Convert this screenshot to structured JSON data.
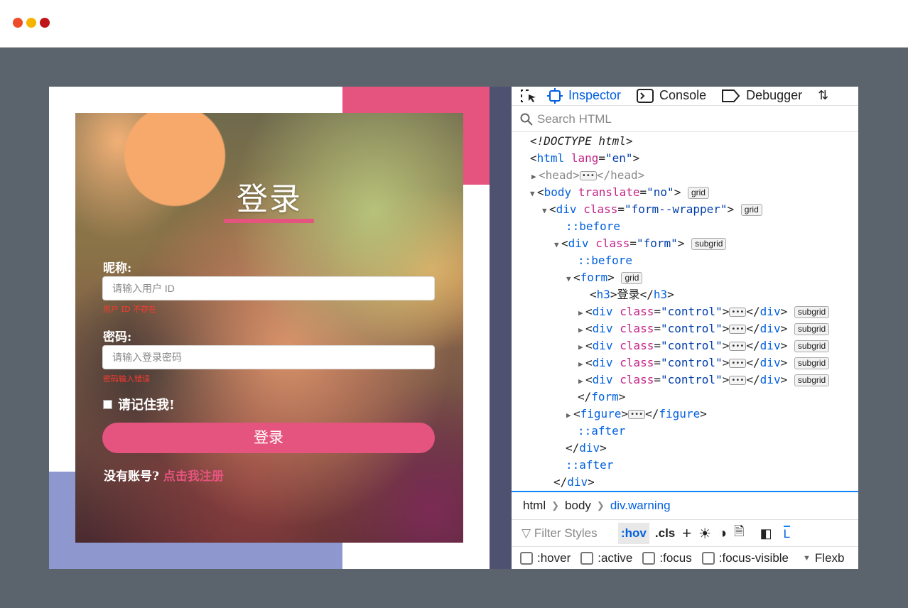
{
  "window": {
    "dots": [
      "close",
      "minimize",
      "maximize"
    ]
  },
  "login": {
    "title": "登录",
    "nickname_label": "昵称:",
    "nickname_placeholder": "请输入用户 ID",
    "nickname_error": "用户 ID 不存在",
    "password_label": "密码:",
    "password_placeholder": "请输入登录密码",
    "password_error": "密码输入错误",
    "remember_label": "请记住我!",
    "submit_label": "登录",
    "signup_text": "没有账号?",
    "signup_link": "点击我注册",
    "colors": {
      "accent": "#e5547e",
      "blue_block": "#8e98cf",
      "error": "#ff3a2e"
    }
  },
  "devtools": {
    "tabs": [
      {
        "label": "Inspector",
        "icon": "inspector-icon"
      },
      {
        "label": "Console",
        "icon": "console-icon"
      },
      {
        "label": "Debugger",
        "icon": "debugger-icon"
      }
    ],
    "search_placeholder": "Search HTML",
    "tree": {
      "doctype": "<!DOCTYPE html>",
      "html_tag": "html",
      "html_attr": "lang",
      "html_val": "\"en\"",
      "head_tag": "head",
      "body_tag": "body",
      "body_attr": "translate",
      "body_val": "\"no\"",
      "body_badge": "grid",
      "wrapper_tag": "div",
      "wrapper_attr": "class",
      "wrapper_val": "\"form--wrapper\"",
      "wrapper_badge": "grid",
      "before1": "::before",
      "form_div_tag": "div",
      "form_div_attr": "class",
      "form_div_val": "\"form\"",
      "form_div_badge": "subgrid",
      "before2": "::before",
      "form_tag": "form",
      "form_badge": "grid",
      "h3_open": "h3",
      "h3_text": "登录",
      "h3_close": "h3",
      "controls": [
        {
          "tag": "div",
          "attr": "class",
          "val": "\"control\"",
          "badge": "subgrid"
        },
        {
          "tag": "div",
          "attr": "class",
          "val": "\"control\"",
          "badge": "subgrid"
        },
        {
          "tag": "div",
          "attr": "class",
          "val": "\"control\"",
          "badge": "subgrid"
        },
        {
          "tag": "div",
          "attr": "class",
          "val": "\"control\"",
          "badge": "subgrid"
        },
        {
          "tag": "div",
          "attr": "class",
          "val": "\"control\"",
          "badge": "subgrid"
        }
      ],
      "form_close": "form",
      "figure_tag": "figure",
      "after1": "::after",
      "div_close1": "div",
      "after2": "::after",
      "div_close2": "div"
    },
    "breadcrumbs": [
      "html",
      "body",
      "div.warning"
    ],
    "filter_placeholder": "Filter Styles",
    "filter_buttons": [
      ":hov",
      ".cls"
    ],
    "states": [
      ":hover",
      ":active",
      ":focus",
      ":focus-visible"
    ],
    "layout_label": "Flexb",
    "layout_tab": "L"
  }
}
